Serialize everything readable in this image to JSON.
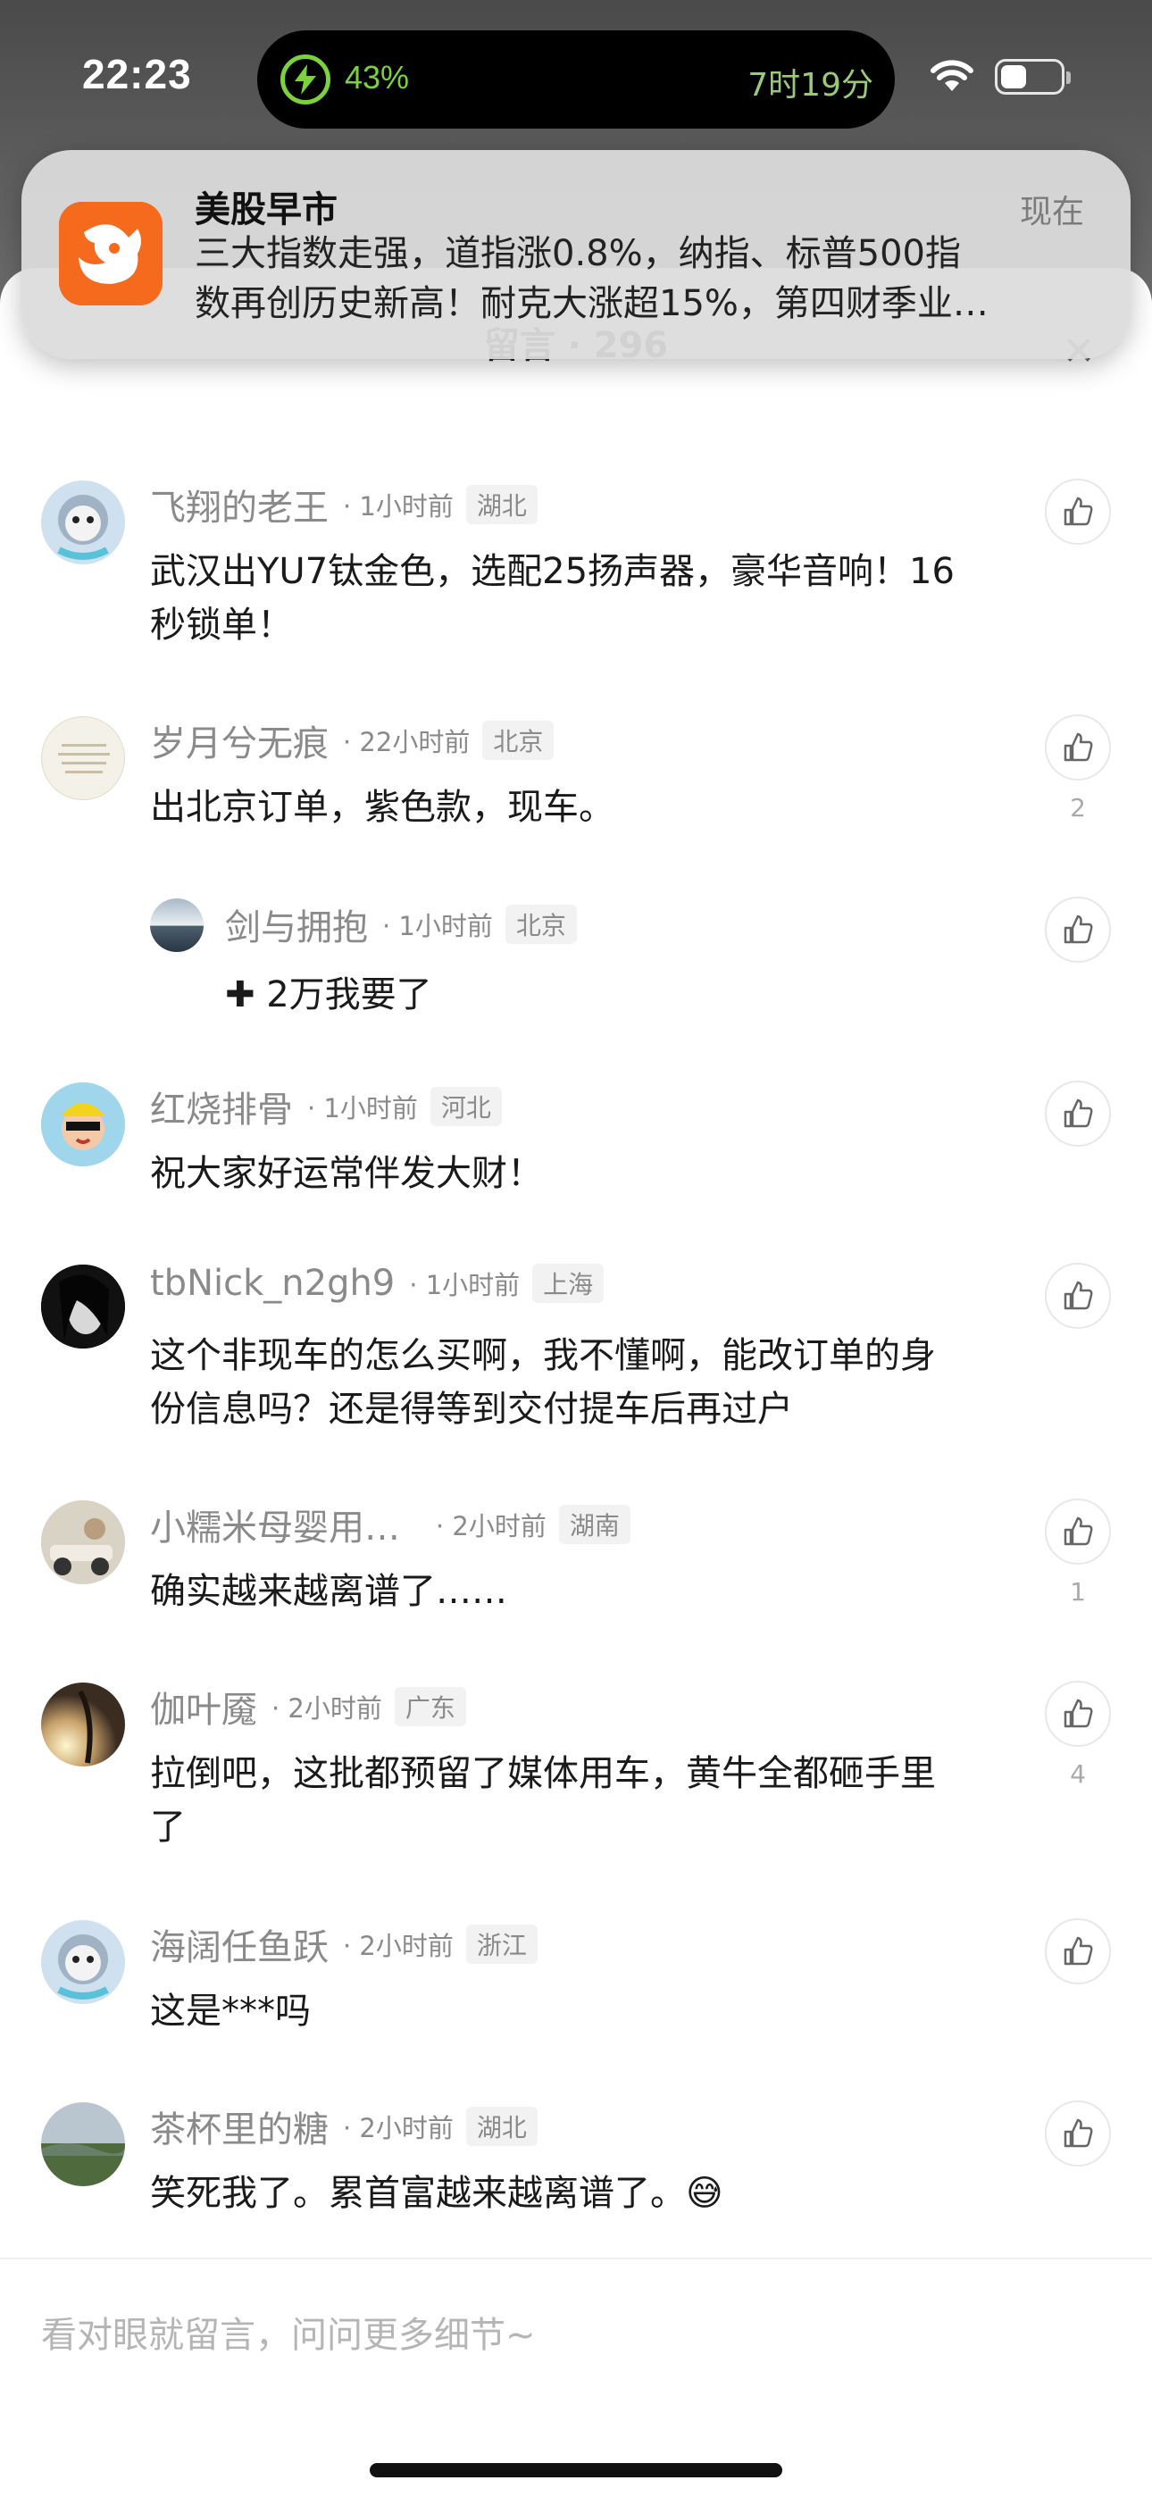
{
  "status": {
    "time": "22:23",
    "battery_percent": "43%",
    "charge_time": "7时19分",
    "battery_level": 0.43
  },
  "notification": {
    "app_name": "美股早市",
    "time": "现在",
    "line1": "三大指数走强，道指涨0.8%，纳指、标普500指",
    "line2": "数再创历史新高！耐克大涨超15%，第四财季业…"
  },
  "sheet": {
    "title": "留言 · 296",
    "close_icon": "close-icon"
  },
  "comments": [
    {
      "user": "飞翔的老王",
      "time": "· 1小时前",
      "region": "湖北",
      "line1": "武汉出YU7钛金色，选配25扬声器，豪华音响！16",
      "line2": "秒锁单！",
      "likes": ""
    },
    {
      "user": "岁月兮无痕",
      "time": "· 22小时前",
      "region": "北京",
      "line1": "出北京订单，紫色款，现车。",
      "line2": "",
      "likes": "2"
    },
    {
      "user": "剑与拥抱",
      "time": "· 1小时前",
      "region": "北京",
      "line1": "✚ 2万我要了",
      "line2": "",
      "likes": ""
    },
    {
      "user": "红烧排骨",
      "time": "· 1小时前",
      "region": "河北",
      "line1": "祝大家好运常伴发大财！",
      "line2": "",
      "likes": ""
    },
    {
      "user": "tbNick_n2gh9",
      "time": "· 1小时前",
      "region": "上海",
      "line1": "这个非现车的怎么买啊，我不懂啊，能改订单的身",
      "line2": "份信息吗？还是得等到交付提车后再过户",
      "likes": ""
    },
    {
      "user": "小糯米母婴用…",
      "time": "· 2小时前",
      "region": "湖南",
      "line1": "确实越来越离谱了……",
      "line2": "",
      "likes": "1"
    },
    {
      "user": "伽叶魇",
      "time": "· 2小时前",
      "region": "广东",
      "line1": "拉倒吧，这批都预留了媒体用车，黄牛全都砸手里",
      "line2": "了",
      "likes": "4"
    },
    {
      "user": "海阔任鱼跃",
      "time": "· 2小时前",
      "region": "浙江",
      "line1": "这是***吗",
      "line2": "",
      "likes": ""
    },
    {
      "user": "茶杯里的糖",
      "time": "· 2小时前",
      "region": "湖北",
      "line1": "笑死我了。累首富越来越离谱了。😅",
      "line2": "",
      "likes": ""
    }
  ],
  "input": {
    "placeholder": "看对眼就留言，问问更多细节~"
  }
}
